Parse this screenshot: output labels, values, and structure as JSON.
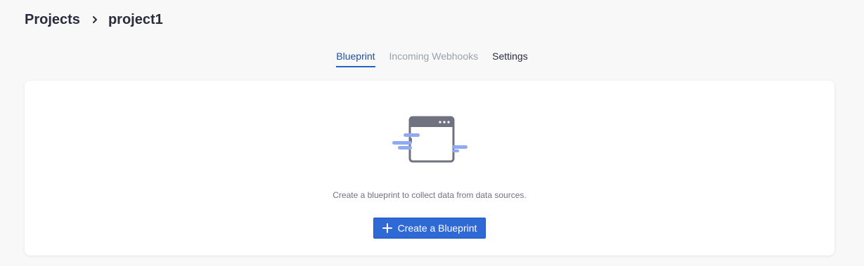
{
  "breadcrumb": {
    "parent": "Projects",
    "separator_icon": "chevron-right-icon",
    "current": "project1"
  },
  "tabs": [
    {
      "label": "Blueprint",
      "state": "active"
    },
    {
      "label": "Incoming Webhooks",
      "state": "disabled"
    },
    {
      "label": "Settings",
      "state": "normal"
    }
  ],
  "empty_state": {
    "illustration_icon": "browser-window-icon",
    "message": "Create a blueprint to collect data from data sources.",
    "button": {
      "icon": "plus-icon",
      "label": "Create a Blueprint"
    }
  },
  "colors": {
    "accent": "#2e69d6",
    "active_tab": "#1e4fa8",
    "disabled_tab": "#9aa0ab",
    "illustration_gray": "#70727f",
    "illustration_blue": "#8fa9f2"
  }
}
